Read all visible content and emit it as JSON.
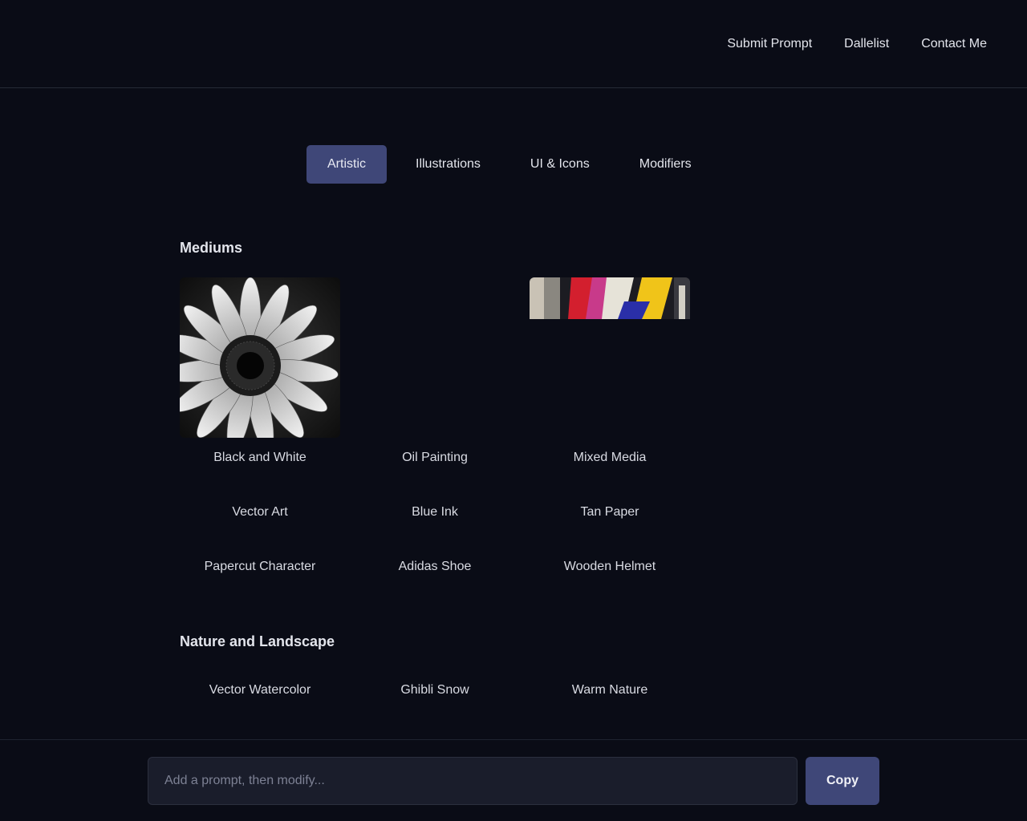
{
  "nav": {
    "links": [
      "Submit Prompt",
      "Dallelist",
      "Contact Me"
    ]
  },
  "tabs": [
    {
      "label": "Artistic",
      "active": true
    },
    {
      "label": "Illustrations",
      "active": false
    },
    {
      "label": "UI & Icons",
      "active": false
    },
    {
      "label": "Modifiers",
      "active": false
    }
  ],
  "sections": [
    {
      "title": "Mediums",
      "items": [
        {
          "label": "Black and White",
          "image": "black-and-white-sunflower"
        },
        {
          "label": "Oil Painting",
          "image": ""
        },
        {
          "label": "Mixed Media",
          "image": "mixed-media-collage-partial"
        },
        {
          "label": "Vector Art",
          "image": ""
        },
        {
          "label": "Blue Ink",
          "image": ""
        },
        {
          "label": "Tan Paper",
          "image": ""
        },
        {
          "label": "Papercut Character",
          "image": ""
        },
        {
          "label": "Adidas Shoe",
          "image": ""
        },
        {
          "label": "Wooden Helmet",
          "image": ""
        }
      ]
    },
    {
      "title": "Nature and Landscape",
      "items": [
        {
          "label": "Vector Watercolor"
        },
        {
          "label": "Ghibli Snow"
        },
        {
          "label": "Warm Nature"
        }
      ]
    }
  ],
  "prompt": {
    "placeholder": "Add a prompt, then modify...",
    "value": "",
    "copy_label": "Copy"
  },
  "colors": {
    "background": "#0a0c16",
    "accent": "#3f4778",
    "input_bg": "#1a1d2b"
  }
}
